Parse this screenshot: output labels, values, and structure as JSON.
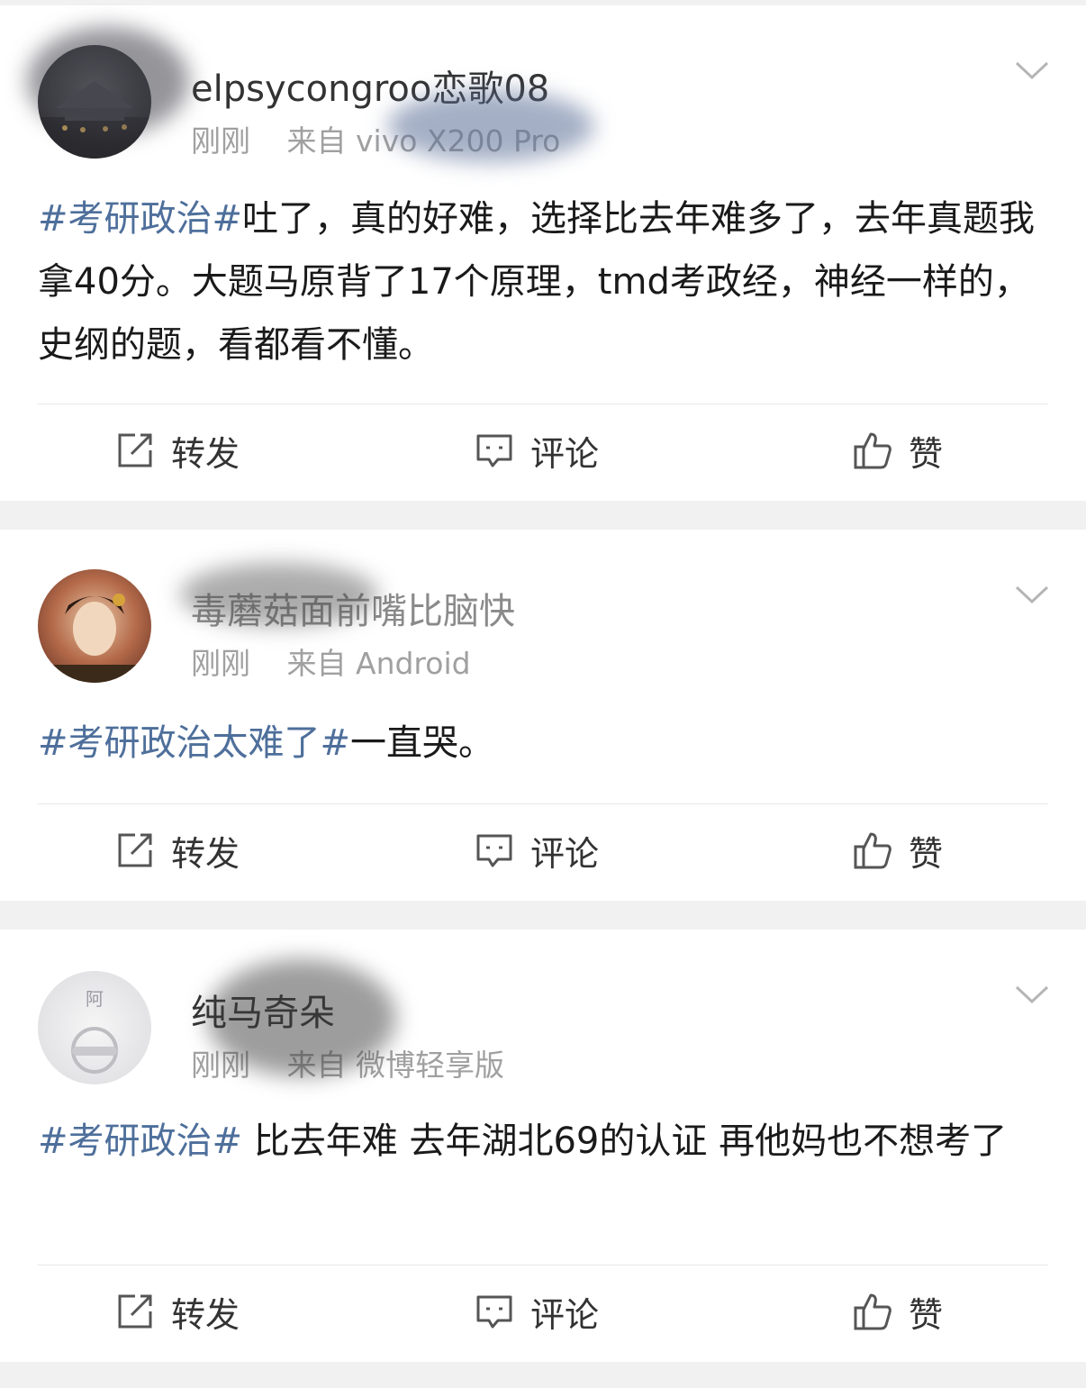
{
  "colors": {
    "hashtag": "#4e6f9b",
    "text": "#1a1a1a",
    "meta": "#a0a0a0",
    "background": "#f1f1f1",
    "card": "#ffffff"
  },
  "posts": [
    {
      "username": "elpsycongroo恋歌08",
      "time": "刚刚",
      "source": "来自 vivo X200 Pro",
      "hashtag": "#考研政治#",
      "text": "吐了，真的好难，选择比去年难多了，去年真题我拿40分。大题马原背了17个原理，tmd考政经，神经一样的，史纲的题，看都看不懂。",
      "actions": {
        "repost": "转发",
        "comment": "评论",
        "like": "赞"
      }
    },
    {
      "username": "毒蘑菇面前嘴比脑快",
      "time": "刚刚",
      "source": "来自 Android",
      "hashtag": "#考研政治太难了#",
      "text": "一直哭。",
      "actions": {
        "repost": "转发",
        "comment": "评论",
        "like": "赞"
      }
    },
    {
      "username": "纯马奇朵",
      "time": "刚刚",
      "source": "来自 微博轻享版",
      "hashtag": "#考研政治#",
      "text": " 比去年难 去年湖北69的认证 再他妈也不想考了",
      "actions": {
        "repost": "转发",
        "comment": "评论",
        "like": "赞"
      }
    }
  ]
}
